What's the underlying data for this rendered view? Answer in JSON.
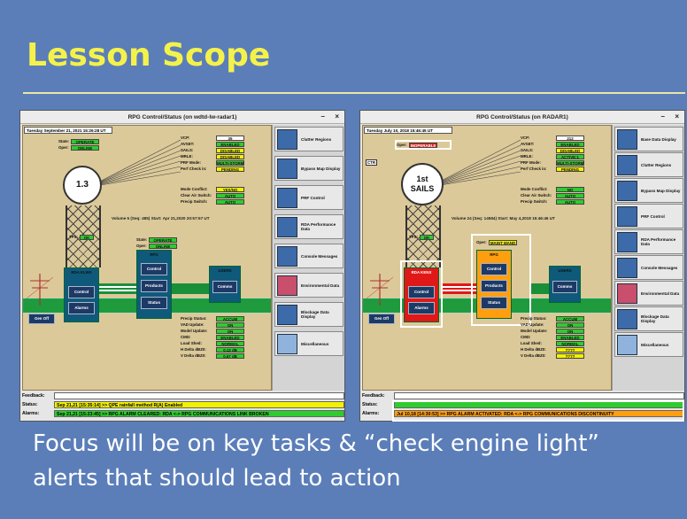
{
  "slide": {
    "title": "Lesson Scope",
    "caption_line1": "Focus will be on key tasks & “check engine light”",
    "caption_line2": "alerts that should lead to action"
  },
  "colors": {
    "background": "#5b7eb9",
    "title": "#f4f24a",
    "ok": "#2ecc2e",
    "warn": "#f2f200",
    "alarm": "#e01818",
    "maint": "#ff9f10"
  },
  "left_window": {
    "title": "RPG Control/Status (on wdtd-lw-radar1)",
    "minimize": "–",
    "close": "×",
    "date": "Tuesday September 21, 2021  15:26:28 UT",
    "state_label": "State:",
    "state_value": "OPERATE",
    "oper_label": "Oper:",
    "oper_value": "ONLINE",
    "status_rows": [
      {
        "k": "VCP:",
        "v": "35",
        "c": "w"
      },
      {
        "k": "AVSET:",
        "v": "ENABLED",
        "c": "g"
      },
      {
        "k": "SAILS:",
        "v": "DISABLED",
        "c": "y"
      },
      {
        "k": "MRLE:",
        "v": "DISABLED",
        "c": "y"
      },
      {
        "k": "PRF Mode:",
        "v": "MULTI-STORM",
        "c": "g"
      },
      {
        "k": "Perf Check in:",
        "v": "PENDING",
        "c": "y"
      }
    ],
    "mode_rows": [
      {
        "k": "Mode Conflict:",
        "v": "YES/NO",
        "c": "y"
      },
      {
        "k": "Clear Air Switch:",
        "v": "AUTO",
        "c": "g"
      },
      {
        "k": "Precip Switch:",
        "v": "AUTO",
        "c": "g"
      }
    ],
    "radar_label": "1.3",
    "volume": "Volume 5 (Seq: 485) Start: Apr 21,2020  20:57:57 UT",
    "tps": "TPS:",
    "tps_value": "OK",
    "rda_label": "RDA KLWX",
    "rda_buttons": [
      "Control",
      "Alarms"
    ],
    "rpg_state": "State:",
    "rpg_state_value": "OPERATE",
    "rpg_oper": "Oper:",
    "rpg_oper_value": "ONLINE",
    "rpg_label": "RPG",
    "rpg_buttons": [
      "Control",
      "Products",
      "Status"
    ],
    "users_label": "USERS",
    "users_button": "Comms",
    "gen_button": "Gen Off",
    "precip_rows": [
      {
        "k": "Precip Status:",
        "v": "ACCUM",
        "c": "g"
      },
      {
        "k": "VAD Update:",
        "v": "ON",
        "c": "g"
      },
      {
        "k": "Model Update:",
        "v": "ON",
        "c": "g"
      },
      {
        "k": "CMD:",
        "v": "ENABLED",
        "c": "g"
      },
      {
        "k": "Load Shed:",
        "v": "NORMAL",
        "c": "g"
      },
      {
        "k": "H Delta dBZ0:",
        "v": "0.13 dB",
        "c": "g"
      },
      {
        "k": "V Delta dBZ0:",
        "v": "0.67 dB",
        "c": "g"
      }
    ],
    "buttons": [
      "Clutter Regions",
      "Bypass Map Display",
      "PRF Control",
      "RDA Performance Data",
      "Console Messages",
      "Environmental Data",
      "Blockage Data Display",
      "Miscellaneous"
    ],
    "feedback_label": "Feedback:",
    "feedback_value": "",
    "status_label": "Status:",
    "status_value": "Sep 21,21 [15:35:14] >> QPE rainfall method R(A) Enabled",
    "alarms_label": "Alarms:",
    "alarms_value": "Sep 21,21 [15:23:45] >> RPG ALARM CLEARED: RDA <-> RPG COMMUNICATIONS LINK BROKEN"
  },
  "right_window": {
    "title": "RPG Control/Status (on RADAR1)",
    "minimize": "–",
    "close": "×",
    "date": "Tuesday July 10, 2018  15:46:45 UT",
    "oper_label": "Oper:",
    "oper_value": "INOPERABLE",
    "ctr": "CTR",
    "status_rows": [
      {
        "k": "VCP:",
        "v": "212",
        "c": "w"
      },
      {
        "k": "AVSET:",
        "v": "ENABLED",
        "c": "g"
      },
      {
        "k": "SAILS:",
        "v": "DISABLED",
        "c": "y"
      },
      {
        "k": "MRLE:",
        "v": "ACTIVE:1",
        "c": "g"
      },
      {
        "k": "PRF Mode:",
        "v": "MULTI-STORM",
        "c": "g"
      },
      {
        "k": "Perf Check in:",
        "v": "PENDING",
        "c": "y"
      }
    ],
    "mode_rows": [
      {
        "k": "Mode Conflict:",
        "v": "NO",
        "c": "g"
      },
      {
        "k": "Clear Air Switch:",
        "v": "AUTO",
        "c": "g"
      },
      {
        "k": "Precip Switch:",
        "v": "AUTO",
        "c": "g"
      }
    ],
    "radar_label_1": "1st",
    "radar_label_2": "SAILS",
    "volume": "Volume 24 (Seq: 14584) Start: May 4,2018  15:46:46 UT",
    "tps": "TPS:",
    "tps_value": "OK",
    "rda_label": "RDA KENX",
    "rda_buttons": [
      "Control",
      "Alarms"
    ],
    "rpg_oper": "Oper:",
    "rpg_oper_value": "MAINT MAND",
    "rpg_label": "RPG",
    "rpg_buttons": [
      "Control",
      "Products",
      "Status"
    ],
    "users_label": "USERS",
    "users_button": "Comms",
    "gen_button": "Gen Off",
    "precip_rows": [
      {
        "k": "Precip Status:",
        "v": "ACCUM",
        "c": "g"
      },
      {
        "k": "VAD Update:",
        "v": "ON",
        "c": "g"
      },
      {
        "k": "Model Update:",
        "v": "ON",
        "c": "g"
      },
      {
        "k": "CMD:",
        "v": "ENABLED",
        "c": "g"
      },
      {
        "k": "Load Shed:",
        "v": "NORMAL",
        "c": "g"
      },
      {
        "k": "H Delta dBZ0:",
        "v": "????",
        "c": "y"
      },
      {
        "k": "V Delta dBZ0:",
        "v": "????",
        "c": "y"
      }
    ],
    "buttons": [
      "Base Data Display",
      "Clutter Regions",
      "Bypass Map Display",
      "PRF Control",
      "RDA Performance Data",
      "Console Messages",
      "Environmental Data",
      "Blockage Data Display",
      "Miscellaneous"
    ],
    "feedback_label": "Feedback:",
    "feedback_value": "",
    "status_label": "Status:",
    "status_value": "",
    "alarms_label": "Alarms:",
    "alarms_value": "Jul 10,18 [14:30:53] >> RPG ALARM ACTIVATED: RDA <-> RPG COMMUNICATIONS DISCONTINUITY"
  }
}
